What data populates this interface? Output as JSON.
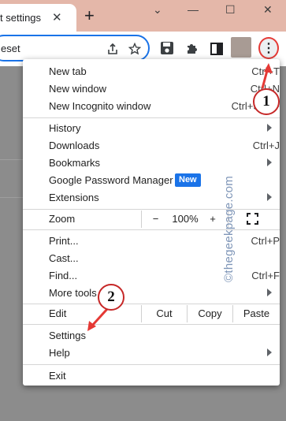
{
  "browser": {
    "tab_title": "t settings",
    "tab_close": "✕",
    "new_tab_symbol": "+",
    "window_controls": {
      "chevron": "⌄",
      "minimize": "—",
      "maximize": "☐",
      "close": "✕"
    },
    "address_text": "eset",
    "toolbar_icons": [
      "share-icon",
      "star-icon",
      "save-icon",
      "extensions-icon",
      "side-panel-icon"
    ],
    "menu_button_glyph": "⋮"
  },
  "menu": {
    "items_top": [
      {
        "label": "New tab",
        "shortcut": "Ctrl+T"
      },
      {
        "label": "New window",
        "shortcut": "Ctrl+N"
      },
      {
        "label": "New Incognito window",
        "shortcut": "Ctrl+Shift+"
      }
    ],
    "items_history": [
      {
        "label": "History",
        "shortcut": ""
      },
      {
        "label": "Downloads",
        "shortcut": "Ctrl+J"
      },
      {
        "label": "Bookmarks",
        "shortcut": ""
      },
      {
        "label": "Google Password Manager",
        "shortcut": "",
        "badge": "New"
      },
      {
        "label": "Extensions",
        "shortcut": ""
      }
    ],
    "zoom": {
      "label": "Zoom",
      "minus": "−",
      "value": "100%",
      "plus": "+"
    },
    "items_tools": [
      {
        "label": "Print...",
        "shortcut": "Ctrl+P"
      },
      {
        "label": "Cast...",
        "shortcut": ""
      },
      {
        "label": "Find...",
        "shortcut": "Ctrl+F"
      },
      {
        "label": "More tools",
        "shortcut": ""
      }
    ],
    "edit": {
      "label": "Edit",
      "cut": "Cut",
      "copy": "Copy",
      "paste": "Paste"
    },
    "items_settings": [
      {
        "label": "Settings"
      },
      {
        "label": "Help"
      }
    ],
    "exit": "Exit"
  },
  "annotations": {
    "callout_1": "1",
    "callout_2": "2",
    "accent_color": "#e53935"
  },
  "watermark": "©thegeekpage.com"
}
